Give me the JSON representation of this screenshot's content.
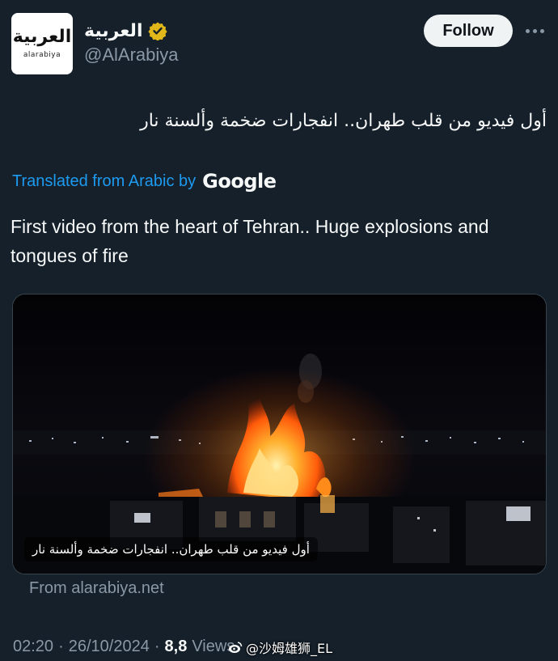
{
  "account": {
    "avatar_logo_text": "العربية",
    "avatar_logo_sub": "alarabiya",
    "display_name": "العربية",
    "handle": "@AlArabiya",
    "follow_label": "Follow"
  },
  "post": {
    "original_text": "أول فيديو من قلب طهران.. انفجارات ضخمة وألسنة نار",
    "translated_prefix": "Translated from Arabic by",
    "translator_brand": "Google",
    "translated_text": "First video from the heart of Tehran.. Huge explosions and tongues of fire",
    "media_caption": "أول فيديو من قلب طهران.. انفجارات ضخمة وألسنة نار",
    "source_label": "From alarabiya.net",
    "time": "02:20",
    "date": "26/10/2024",
    "separator": "·",
    "views_count": "8,8",
    "views_label": "Views"
  },
  "watermark": {
    "text": "@沙姆雄狮_EL"
  },
  "colors": {
    "background": "#15202b",
    "link": "#1d9bf0",
    "secondary_text": "#8b98a5",
    "verified_badge": "#e2b719"
  },
  "icons": {
    "verified": "verified-badge-icon",
    "more": "more-horizontal-icon",
    "watermark_logo": "weibo-logo-icon"
  }
}
